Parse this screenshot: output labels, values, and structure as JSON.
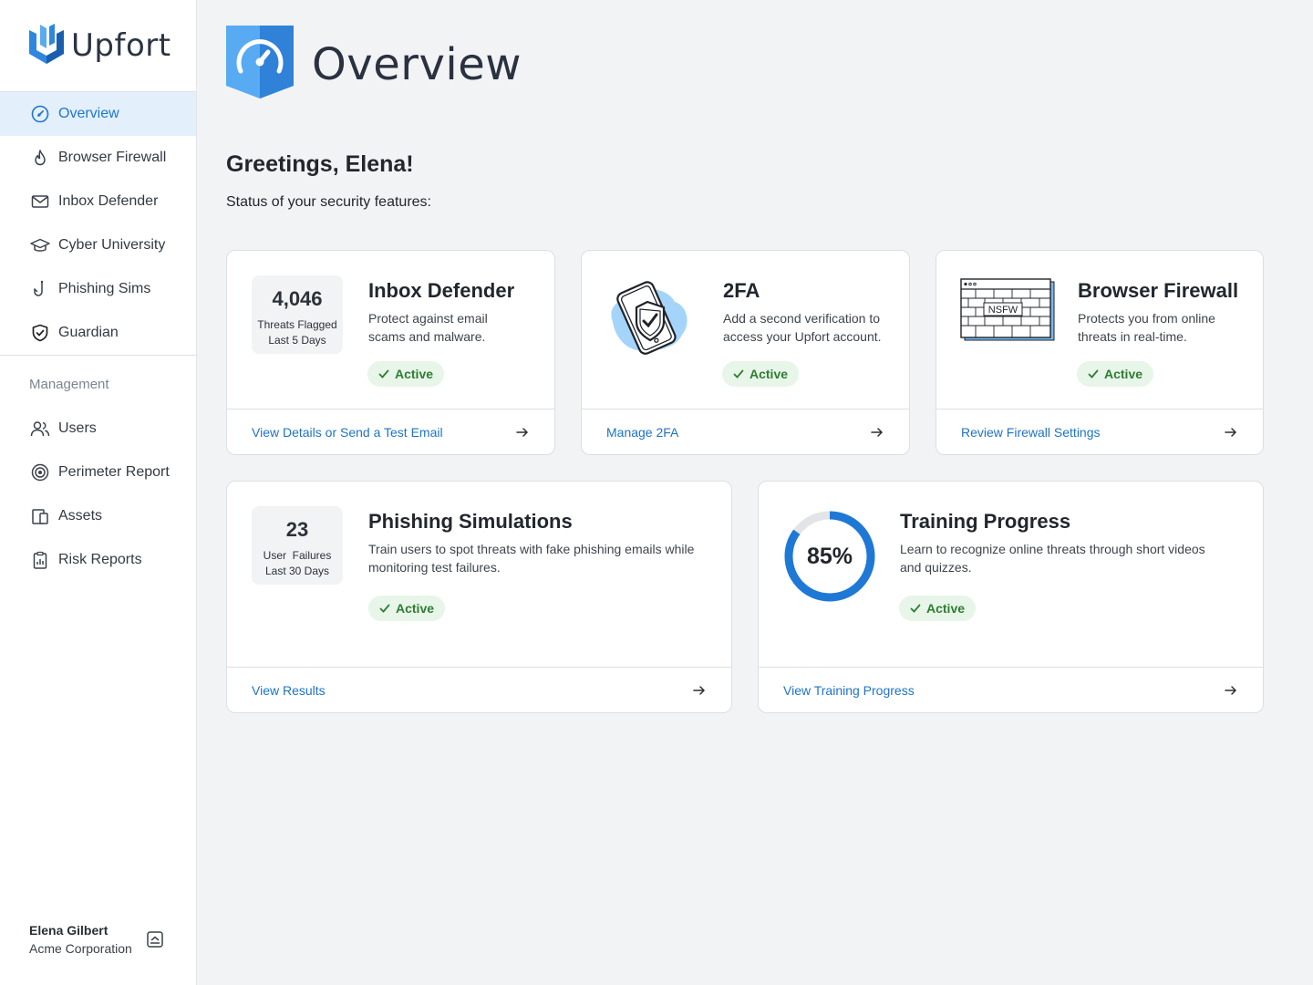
{
  "brand": {
    "name": "Upfort"
  },
  "nav": {
    "items": [
      {
        "label": "Overview",
        "icon": "gauge-icon",
        "active": true
      },
      {
        "label": "Browser Firewall",
        "icon": "flame-icon"
      },
      {
        "label": "Inbox Defender",
        "icon": "mail-icon"
      },
      {
        "label": "Cyber University",
        "icon": "graduation-cap-icon"
      },
      {
        "label": "Phishing Sims",
        "icon": "fishing-hook-icon"
      },
      {
        "label": "Guardian",
        "icon": "shield-check-icon"
      }
    ],
    "section_label": "Management",
    "management": [
      {
        "label": "Users",
        "icon": "users-icon"
      },
      {
        "label": "Perimeter Report",
        "icon": "target-icon"
      },
      {
        "label": "Assets",
        "icon": "devices-icon"
      },
      {
        "label": "Risk Reports",
        "icon": "clipboard-icon"
      }
    ]
  },
  "user": {
    "name": "Elena Gilbert",
    "org": "Acme Corporation"
  },
  "header": {
    "title": "Overview"
  },
  "greeting": "Greetings, Elena!",
  "subtitle": "Status of your security features:",
  "cards": {
    "inbox": {
      "stat_value": "4,046",
      "stat_label_1": "Threats Flagged",
      "stat_label_2": "Last 5 Days",
      "title": "Inbox Defender",
      "desc": "Protect against email scams and malware.",
      "status": "Active",
      "link": "View Details or Send a Test Email"
    },
    "twofa": {
      "title": "2FA",
      "desc": "Add a second verification to access your Upfort account.",
      "status": "Active",
      "link": "Manage 2FA"
    },
    "firewall": {
      "title": "Browser Firewall",
      "desc": "Protects you from online threats in real-time.",
      "status": "Active",
      "link": "Review Firewall Settings",
      "illustration_text": "NSFW"
    },
    "phishing": {
      "stat_value": "23",
      "stat_label_1": "User  Failures",
      "stat_label_2": "Last 30 Days",
      "title": "Phishing Simulations",
      "desc": "Train users to spot threats with fake phishing emails while monitoring test failures.",
      "status": "Active",
      "link": "View Results"
    },
    "training": {
      "progress_label": "85%",
      "progress": 0.85,
      "title": "Training Progress",
      "desc": "Learn to recognize online threats through short videos and quizzes.",
      "status": "Active",
      "link": "View Training Progress"
    }
  },
  "colors": {
    "accent": "#1e73c8",
    "active_bg": "#e8f5e9",
    "active_text": "#2e7d32",
    "nav_active_bg": "#e3f0fb"
  }
}
